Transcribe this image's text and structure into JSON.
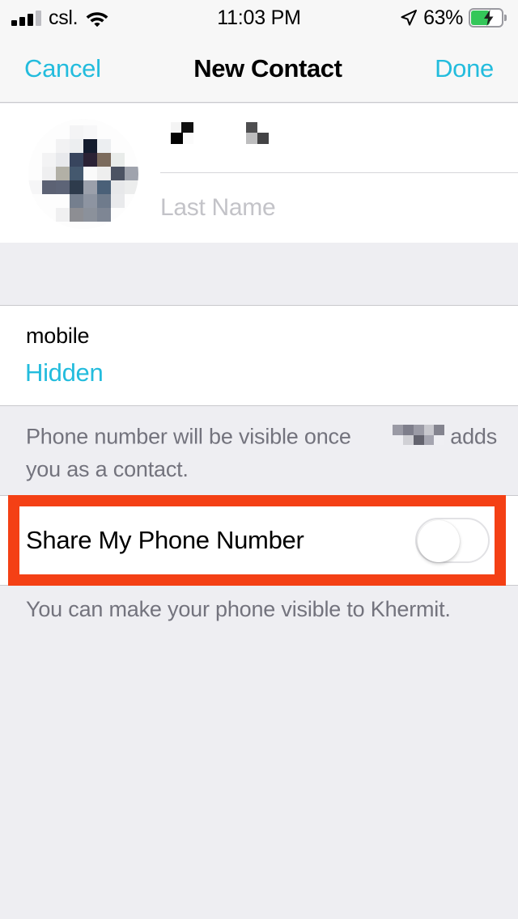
{
  "status_bar": {
    "carrier": "csl.",
    "time": "11:03 PM",
    "battery_percent": "63%",
    "signal_bars_filled": 3,
    "signal_bars_total": 4,
    "icons": [
      "signal-bars-icon",
      "wifi-icon",
      "location-arrow-icon",
      "battery-charging-icon"
    ]
  },
  "nav_bar": {
    "cancel_label": "Cancel",
    "title": "New Contact",
    "done_label": "Done"
  },
  "contact": {
    "avatar": "contact-photo-pixelated",
    "first_name_value": "",
    "first_name_redacted": true,
    "last_name_placeholder": "Last Name",
    "last_name_value": ""
  },
  "phone": {
    "type_label": "mobile",
    "value": "Hidden",
    "footnote": "Phone number will be visible once           adds you as a contact.",
    "footnote_redacted_name": true
  },
  "share": {
    "label": "Share My Phone Number",
    "toggle_state": "off",
    "footnote": "You can make your phone visible to Khermit."
  },
  "annotation": {
    "highlight_target": "share-my-phone-number-row",
    "color": "#f44015"
  },
  "colors": {
    "accent": "#23bcdd",
    "highlight": "#f44015",
    "background": "#eeeef2",
    "card": "#ffffff",
    "battery_green": "#34c759",
    "secondary_text": "#73737d"
  }
}
